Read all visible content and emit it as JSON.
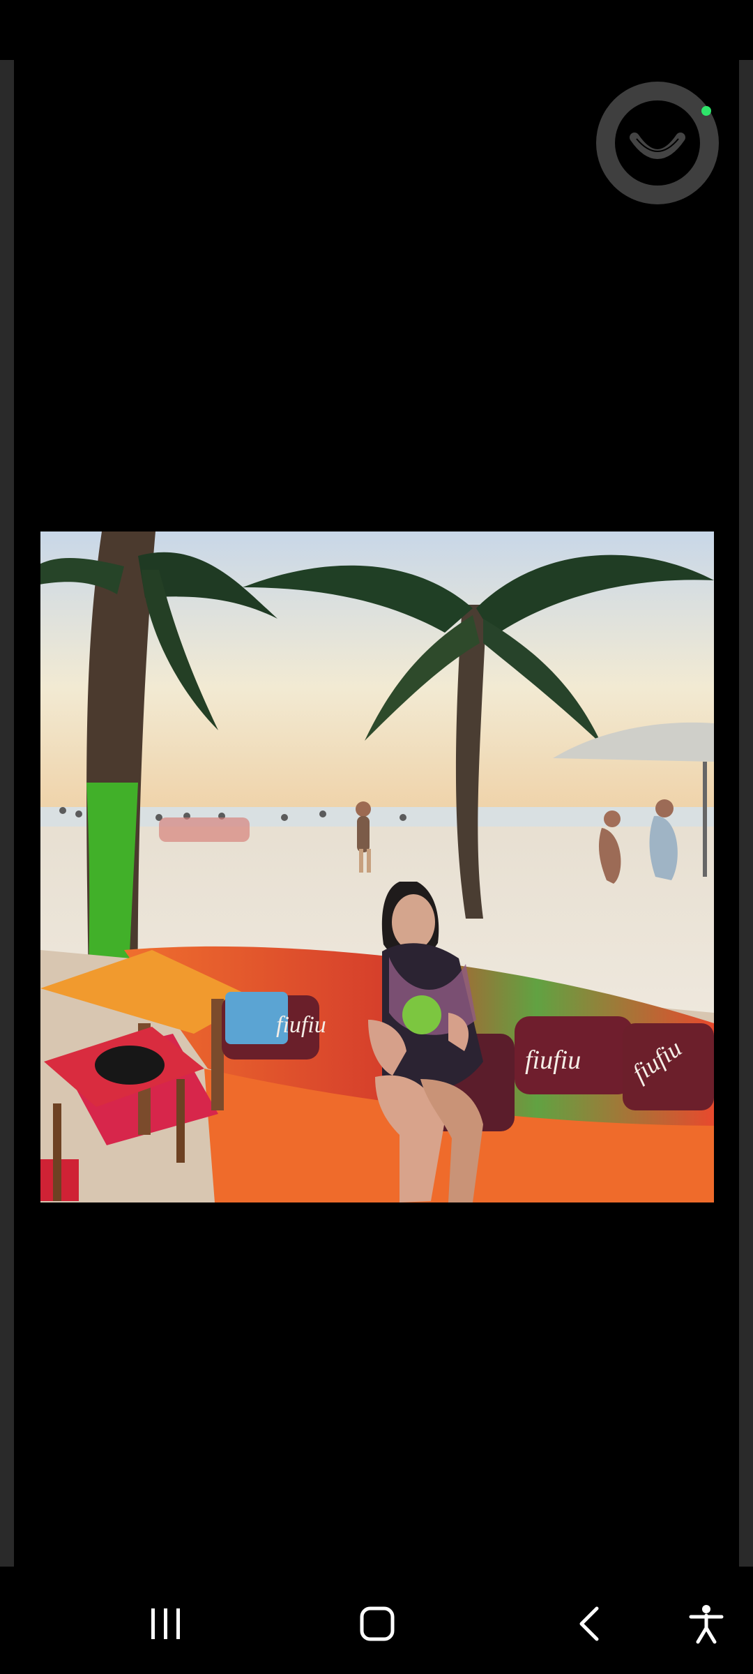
{
  "viewer": {
    "emoji_icon": "smile-face-icon",
    "image_alt": "Woman seated in a decorated beach boat with palm trees and beachgoers",
    "pillow_text": [
      "fiufiu",
      "fiufiu",
      "fiufiu"
    ]
  },
  "navigation": {
    "recent_apps_icon": "recent-apps-icon",
    "home_icon": "home-icon",
    "back_icon": "back-icon",
    "accessibility_icon": "accessibility-icon"
  },
  "colors": {
    "background": "#000000",
    "frame_edge": "#2a2a2a",
    "emoji_button": "#3f3f3f",
    "online_dot": "#2ee56a",
    "nav_icon": "#ffffff"
  }
}
